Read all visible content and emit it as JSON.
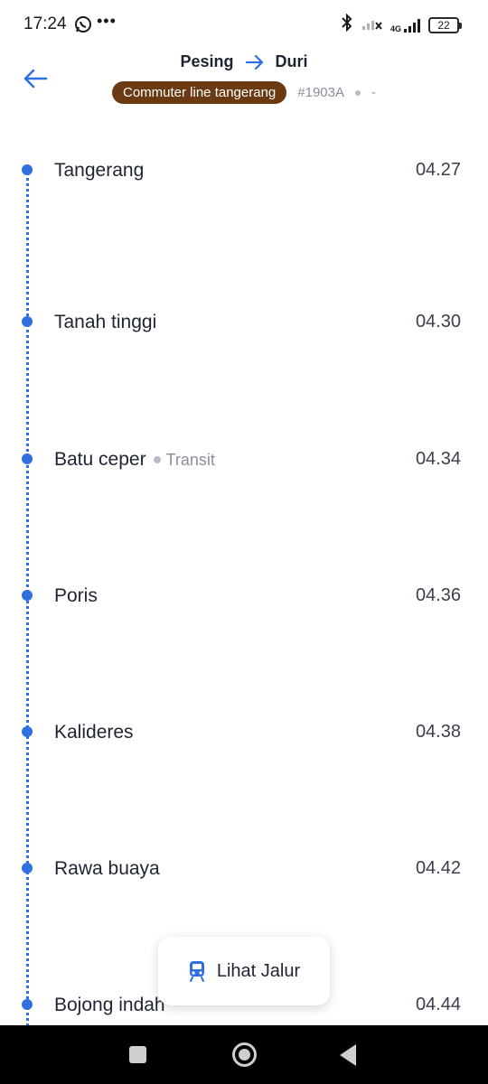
{
  "status_bar": {
    "time": "17:24",
    "dots": "•••",
    "network": "4G",
    "battery": "22"
  },
  "header": {
    "origin": "Pesing",
    "destination": "Duri",
    "line_name": "Commuter line tangerang",
    "train_number": "#1903A",
    "extra": "-",
    "line_color": "#6b3a12",
    "accent_color": "#2f6fe0"
  },
  "stops": [
    {
      "name": "Tangerang",
      "time": "04.27"
    },
    {
      "name": "Tanah tinggi",
      "time": "04.30"
    },
    {
      "name": "Batu ceper",
      "time": "04.34",
      "tag": "Transit"
    },
    {
      "name": "Poris",
      "time": "04.36"
    },
    {
      "name": "Kalideres",
      "time": "04.38"
    },
    {
      "name": "Rawa buaya",
      "time": "04.42"
    },
    {
      "name": "Bojong indah",
      "time": "04.44"
    }
  ],
  "fab": {
    "label": "Lihat Jalur",
    "icon": "train-icon"
  },
  "nav": {
    "icons": [
      "recents-icon",
      "home-icon",
      "back-icon"
    ]
  }
}
